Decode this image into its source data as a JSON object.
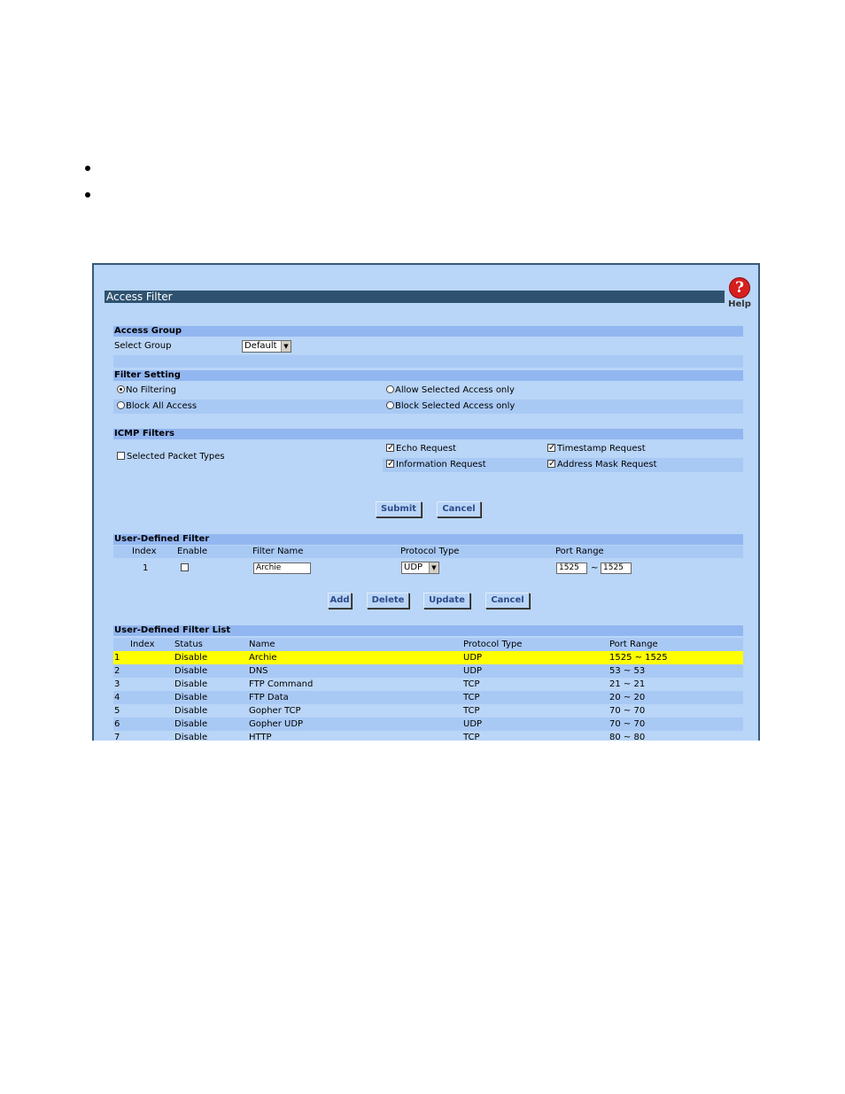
{
  "window": {
    "title": "Access Filter",
    "help_label": "Help"
  },
  "access_group": {
    "heading": "Access Group",
    "select_label": "Select Group",
    "select_value": "Default"
  },
  "filter_setting": {
    "heading": "Filter Setting",
    "options": [
      "No Filtering",
      "Allow Selected Access only",
      "Block All Access",
      "Block Selected Access only"
    ],
    "selected": "No Filtering"
  },
  "icmp": {
    "heading": "ICMP Filters",
    "selected_packet_types": "Selected Packet Types",
    "echo_request": "Echo Request",
    "timestamp_request": "Timestamp Request",
    "information_request": "Information Request",
    "address_mask_request": "Address Mask Request"
  },
  "buttons": {
    "submit": "Submit",
    "cancel": "Cancel",
    "add": "Add",
    "delete": "Delete",
    "update": "Update"
  },
  "user_defined_filter": {
    "heading": "User-Defined Filter",
    "columns": [
      "Index",
      "Enable",
      "Filter Name",
      "Protocol Type",
      "Port Range"
    ],
    "index": "1",
    "filter_name": "Archie",
    "protocol": "UDP",
    "port_from": "1525",
    "port_sep": "~",
    "port_to": "1525"
  },
  "filter_list": {
    "heading": "User-Defined Filter List",
    "columns": [
      "Index",
      "Status",
      "Name",
      "Protocol Type",
      "Port Range"
    ],
    "rows": [
      [
        "1",
        "Disable",
        "Archie",
        "UDP",
        "1525 ~ 1525"
      ],
      [
        "2",
        "Disable",
        "DNS",
        "UDP",
        "53 ~ 53"
      ],
      [
        "3",
        "Disable",
        "FTP Command",
        "TCP",
        "21 ~ 21"
      ],
      [
        "4",
        "Disable",
        "FTP Data",
        "TCP",
        "20 ~ 20"
      ],
      [
        "5",
        "Disable",
        "Gopher TCP",
        "TCP",
        "70 ~ 70"
      ],
      [
        "6",
        "Disable",
        "Gopher UDP",
        "UDP",
        "70 ~ 70"
      ],
      [
        "7",
        "Disable",
        "HTTP",
        "TCP",
        "80 ~ 80"
      ]
    ]
  }
}
